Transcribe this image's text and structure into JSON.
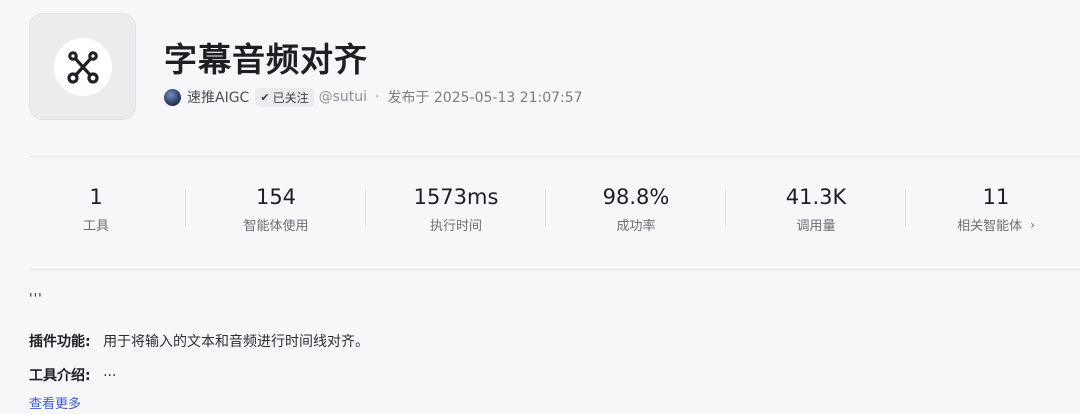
{
  "plugin": {
    "icon": "scissors-icon",
    "title": "字幕音频对齐",
    "author": "速推AIGC",
    "follow_label": "已关注",
    "handle": "@sutui",
    "separator": "·",
    "published": "发布于 2025-05-13 21:07:57"
  },
  "stats": [
    {
      "value": "1",
      "label": "工具"
    },
    {
      "value": "154",
      "label": "智能体使用"
    },
    {
      "value": "1573ms",
      "label": "执行时间"
    },
    {
      "value": "98.8%",
      "label": "成功率"
    },
    {
      "value": "41.3K",
      "label": "调用量"
    },
    {
      "value": "11",
      "label": "相关智能体"
    }
  ],
  "description": {
    "quote": "'''",
    "function_key": "插件功能:",
    "function_value": "用于将输入的文本和音频进行时间线对齐。",
    "intro_key": "工具介绍:",
    "intro_value": "···",
    "more_link": "查看更多"
  },
  "colors": {
    "link": "#3b5bdb",
    "background": "#f7f7fa"
  }
}
